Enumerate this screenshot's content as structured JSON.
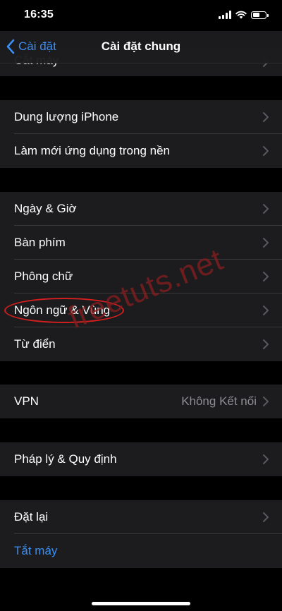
{
  "status_bar": {
    "time": "16:35"
  },
  "nav": {
    "back_label": "Cài đặt",
    "title": "Cài đặt chung"
  },
  "partial_row": {
    "label": "Cắt máy"
  },
  "groups": [
    {
      "items": [
        {
          "label": "Dung lượng iPhone"
        },
        {
          "label": "Làm mới ứng dụng trong nền"
        }
      ]
    },
    {
      "items": [
        {
          "label": "Ngày & Giờ"
        },
        {
          "label": "Bàn phím"
        },
        {
          "label": "Phông chữ"
        },
        {
          "label": "Ngôn ngữ & Vùng"
        },
        {
          "label": "Từ điển"
        }
      ]
    },
    {
      "items": [
        {
          "label": "VPN",
          "value": "Không Kết nối"
        }
      ]
    },
    {
      "items": [
        {
          "label": "Pháp lý & Quy định"
        }
      ]
    },
    {
      "items": [
        {
          "label": "Đặt lại"
        },
        {
          "label": "Tắt máy"
        }
      ]
    }
  ],
  "watermark": "freetuts.net",
  "colors": {
    "accent": "#3b8ef6",
    "background": "#000000",
    "cell": "#1c1c1e",
    "annotation": "#d41f1f"
  },
  "icons": [
    "back-chevron-icon",
    "chevron-right-icon",
    "signal-icon",
    "wifi-icon",
    "battery-icon"
  ]
}
